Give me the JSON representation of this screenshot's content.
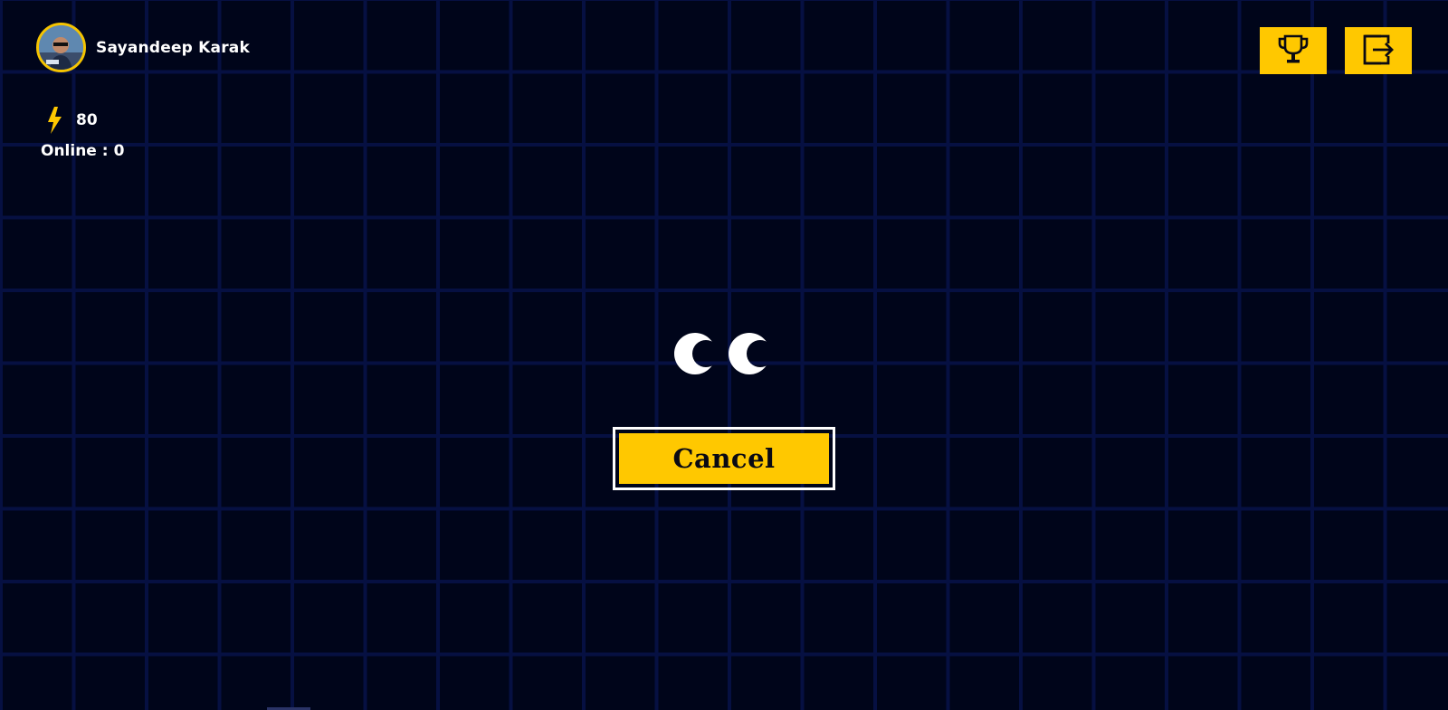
{
  "user": {
    "name": "Sayandeep Karak",
    "avatar_icon": "user-avatar"
  },
  "stats": {
    "energy_icon": "lightning-bolt-icon",
    "energy": "80",
    "online_label": "Online :",
    "online_count": "0"
  },
  "toolbar": {
    "leaderboard_icon": "trophy-icon",
    "logout_icon": "logout-icon"
  },
  "loader": {
    "icon": "crescent-loader-icon"
  },
  "actions": {
    "cancel_label": "Cancel"
  },
  "colors": {
    "background": "#00051a",
    "grid": "#061042",
    "accent": "#ffc800",
    "text": "#ffffff"
  }
}
